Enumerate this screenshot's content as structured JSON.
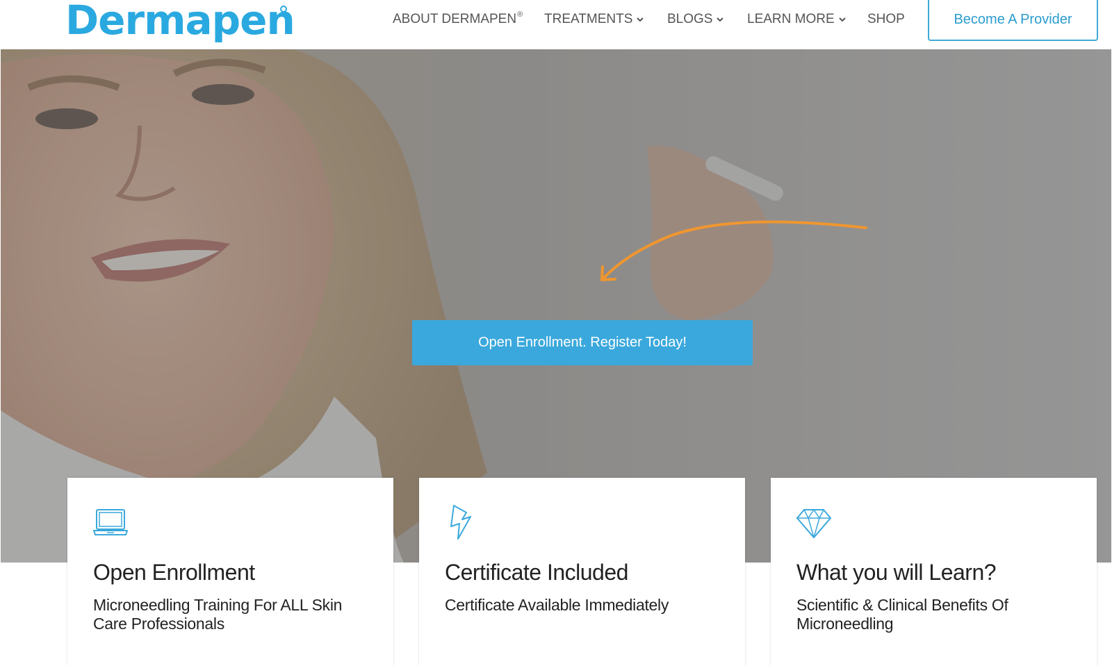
{
  "header": {
    "logo": "Dermapen",
    "nav": [
      {
        "label": "ABOUT DERMAPEN",
        "sup": "®",
        "dropdown": false
      },
      {
        "label": "TREATMENTS",
        "dropdown": true
      },
      {
        "label": "BLOGS",
        "dropdown": true
      },
      {
        "label": "LEARN MORE",
        "dropdown": true
      },
      {
        "label": "SHOP",
        "dropdown": false
      }
    ],
    "provider_button": "Become A Provider"
  },
  "hero": {
    "cta_label": "Open Enrollment. Register Today!",
    "arrow_color": "#f0962f"
  },
  "cards": [
    {
      "icon": "laptop-icon",
      "title": "Open Enrollment",
      "description": "Microneedling Training For ALL Skin Care Professionals"
    },
    {
      "icon": "lightning-icon",
      "title": "Certificate Included",
      "description": "Certificate Available Immediately"
    },
    {
      "icon": "diamond-icon",
      "title": "What you will Learn?",
      "description": "Scientific & Clinical Benefits Of Microneedling"
    }
  ],
  "colors": {
    "brand": "#2aa9e0",
    "cta": "#3aa8dc",
    "icon": "#3aa8dc"
  }
}
